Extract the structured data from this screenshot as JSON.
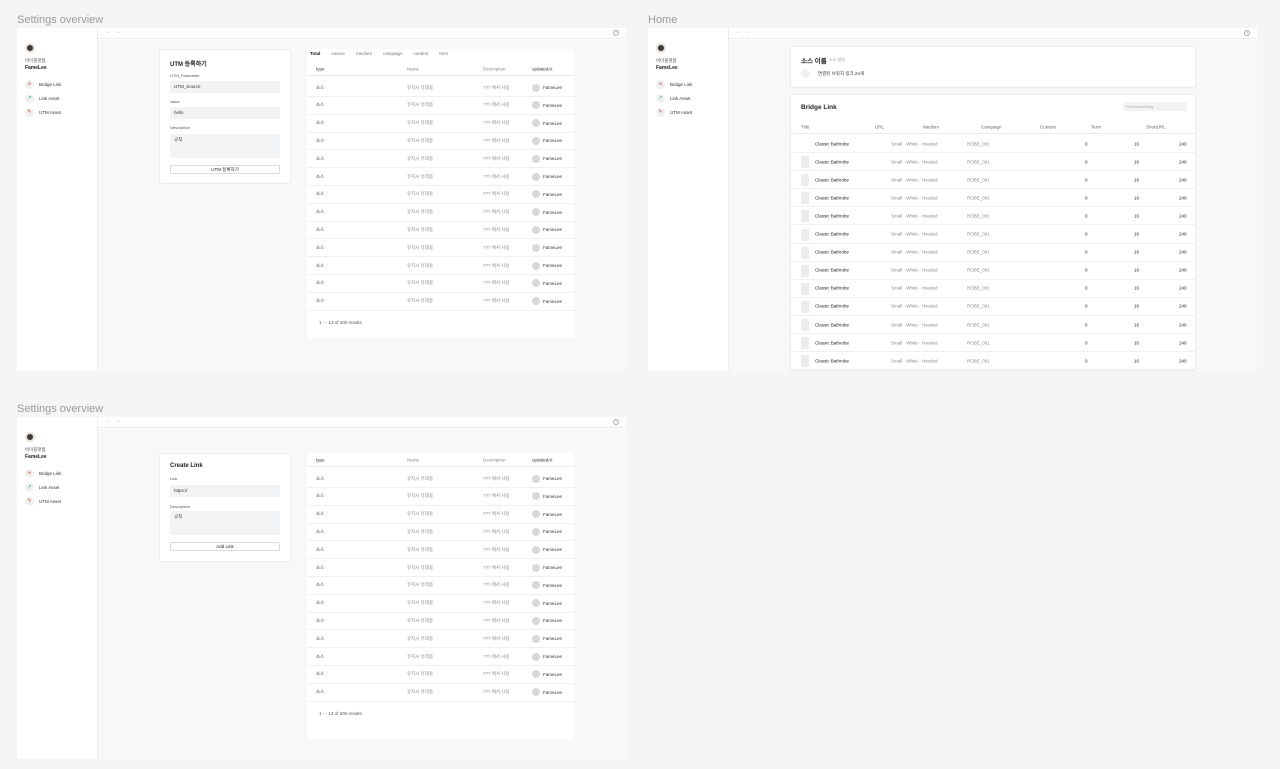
{
  "sidebar": {
    "sub": "바이플랫폼",
    "user": "FameLee",
    "items": [
      {
        "label": "Bridge Link",
        "icon": "link-icon"
      },
      {
        "label": "Link Asset",
        "icon": "chart-icon"
      },
      {
        "label": "UTM Asset",
        "icon": "pen-icon"
      }
    ]
  },
  "frames": {
    "settings1_title": "Settings overview",
    "home_title": "Home",
    "settings2_title": "Settings overview"
  },
  "topbar": {
    "back": "←",
    "forward": "→",
    "help": "?"
  },
  "utm_form": {
    "title": "UTM 등록하기",
    "param_label": "UTM_Parameter",
    "param_value": "UTM_Source",
    "value_label": "value",
    "value_value": "hello",
    "desc_label": "Description",
    "desc_value": "규칙",
    "submit": "UTM 등록하기"
  },
  "link_form": {
    "title": "Create Link",
    "link_label": "Link",
    "link_value": "https://",
    "desc_label": "Description",
    "desc_value": "규칙",
    "submit": "Add Link"
  },
  "tabs": [
    {
      "label": "Total",
      "active": true
    },
    {
      "label": "source",
      "active": false
    },
    {
      "label": "medium",
      "active": false
    },
    {
      "label": "campaign",
      "active": false
    },
    {
      "label": "content",
      "active": false
    },
    {
      "label": "term",
      "active": false
    }
  ],
  "utm_table": {
    "headers": {
      "type": "type",
      "name": "Name",
      "desc": "Description",
      "updated": "updatedAt"
    },
    "row": {
      "type": "소스",
      "name": "유지시 유데용",
      "desc": "??? 에서 사용",
      "updated": "FameLee"
    },
    "row_count": 13,
    "pager": "1  ···  13 of 200 results"
  },
  "source": {
    "title": "소스 이름",
    "subtitle": "소스 설명",
    "linked": "연결된 브릿지 링크 24개"
  },
  "bridge": {
    "title": "Bridge Link",
    "search_placeholder": "Find something",
    "headers": {
      "title": "Title",
      "url": "URL",
      "medium": "Medium",
      "campaign": "Campaign",
      "content": "Content",
      "term": "Term",
      "short": "ShortURL"
    },
    "row": {
      "title": "Classic Bathrobe",
      "medium": "Small · White · Hooded",
      "campaign": "ROBE_001",
      "content": "0",
      "term": "16",
      "short": "240"
    },
    "row_count": 13
  }
}
